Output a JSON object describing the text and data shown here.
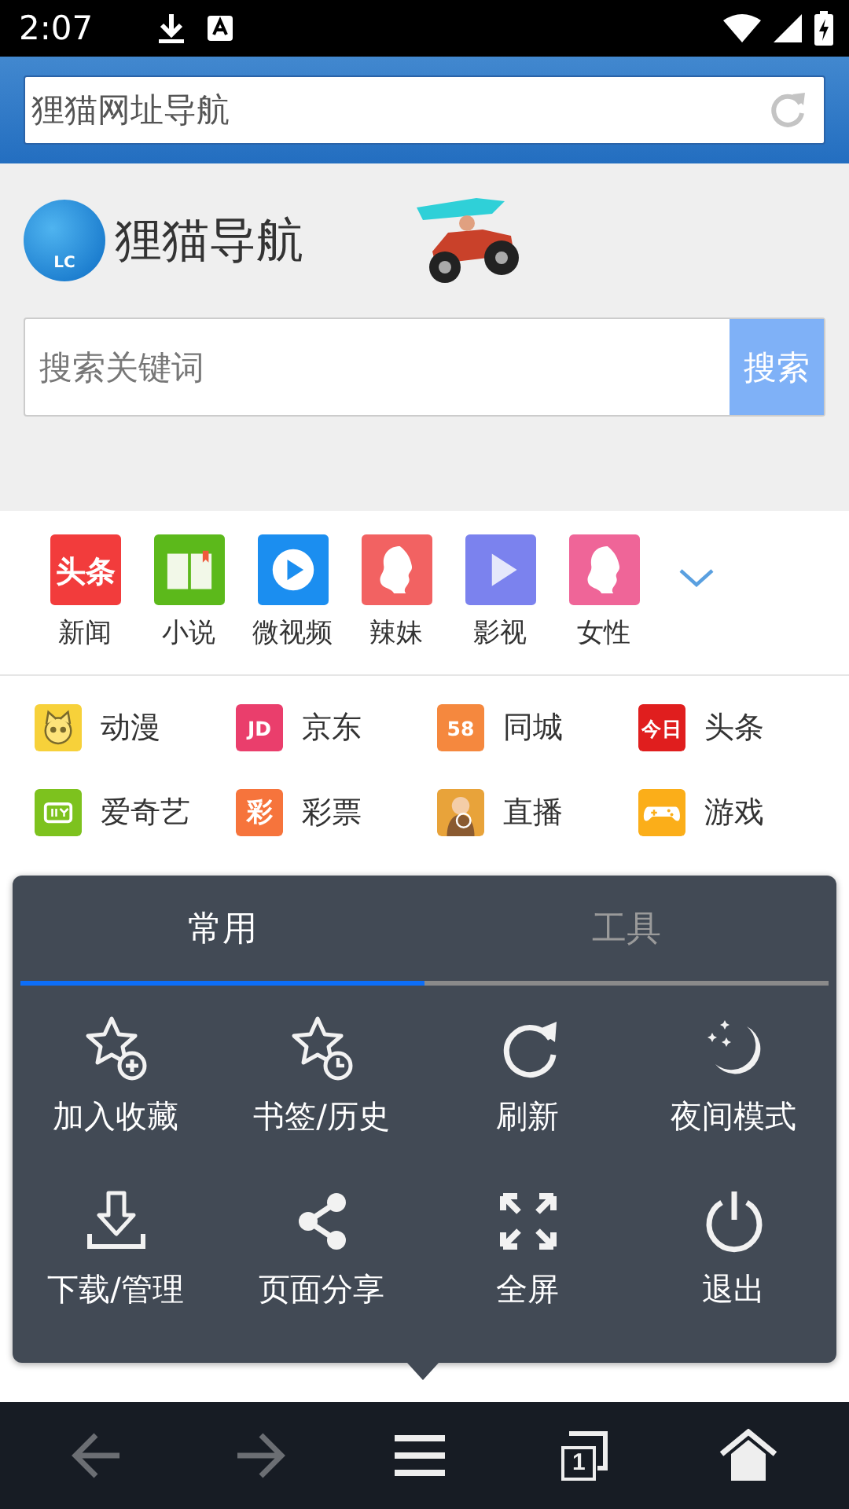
{
  "status_bar": {
    "time": "2:07"
  },
  "address_bar": {
    "value": "狸猫网址导航"
  },
  "logo": {
    "mark": "LC",
    "name": "狸猫导航"
  },
  "search": {
    "placeholder": "搜索关键词",
    "button": "搜索"
  },
  "tiles": [
    {
      "label": "新闻",
      "color": "#f23c3c",
      "kind": "text",
      "glyph": "头条"
    },
    {
      "label": "小说",
      "color": "#5cb91b",
      "kind": "book"
    },
    {
      "label": "微视频",
      "color": "#1b8ef0",
      "kind": "play-circle"
    },
    {
      "label": "辣妹",
      "color": "#f26262",
      "kind": "girl"
    },
    {
      "label": "影视",
      "color": "#7b82ee",
      "kind": "play"
    },
    {
      "label": "女性",
      "color": "#ef6598",
      "kind": "girl"
    }
  ],
  "links": [
    {
      "label": "动漫",
      "color": "#f7d13a",
      "kind": "cat"
    },
    {
      "label": "京东",
      "color": "#ea3e6c",
      "kind": "text",
      "glyph": "JD"
    },
    {
      "label": "同城",
      "color": "#f5883e",
      "kind": "text",
      "glyph": "58"
    },
    {
      "label": "头条",
      "color": "#e01e1e",
      "kind": "text",
      "glyph": "今日"
    },
    {
      "label": "爱奇艺",
      "color": "#7dc21e",
      "kind": "tv"
    },
    {
      "label": "彩票",
      "color": "#f6743c",
      "kind": "text",
      "glyph": "彩"
    },
    {
      "label": "直播",
      "color": "#e8a33a",
      "kind": "photo"
    },
    {
      "label": "游戏",
      "color": "#fbae19",
      "kind": "gamepad"
    }
  ],
  "menu": {
    "tabs": [
      {
        "label": "常用",
        "selected": true
      },
      {
        "label": "工具",
        "selected": false
      }
    ],
    "items": [
      {
        "label": "加入收藏",
        "kind": "star-plus"
      },
      {
        "label": "书签/历史",
        "kind": "star-clock"
      },
      {
        "label": "刷新",
        "kind": "refresh"
      },
      {
        "label": "夜间模式",
        "kind": "moon"
      },
      {
        "label": "下载/管理",
        "kind": "download"
      },
      {
        "label": "页面分享",
        "kind": "share"
      },
      {
        "label": "全屏",
        "kind": "fullscreen"
      },
      {
        "label": "退出",
        "kind": "power"
      }
    ]
  },
  "bottom_nav": [
    {
      "kind": "back",
      "disabled": true
    },
    {
      "kind": "forward",
      "disabled": true
    },
    {
      "kind": "menu",
      "disabled": false
    },
    {
      "kind": "tabs",
      "disabled": false,
      "count": "1"
    },
    {
      "kind": "home",
      "disabled": false
    }
  ]
}
